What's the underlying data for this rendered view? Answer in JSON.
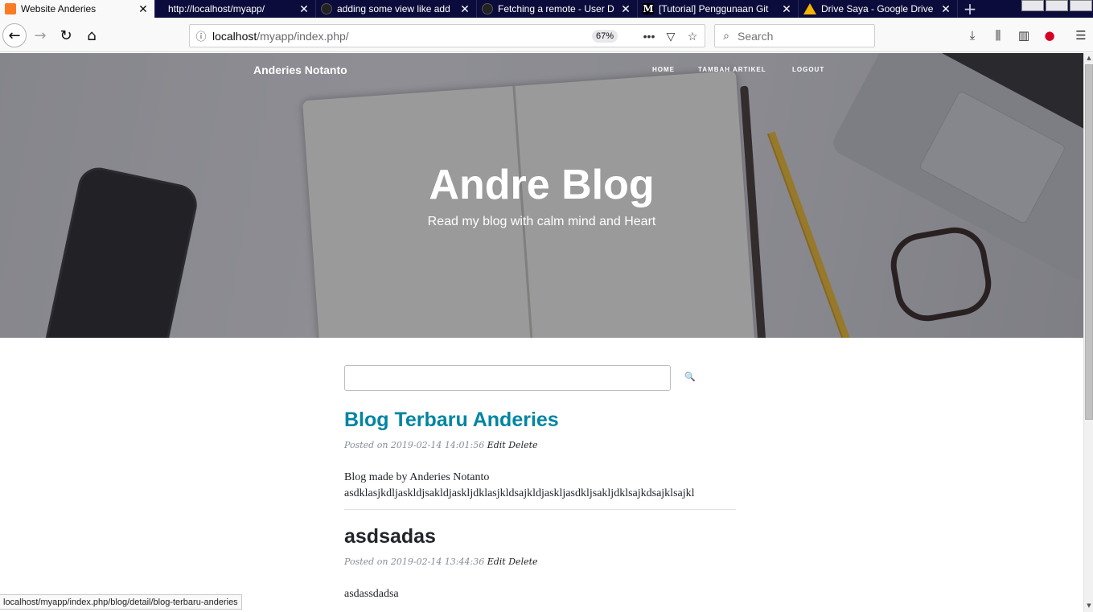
{
  "browser": {
    "tabs": [
      {
        "title": "Website Anderies",
        "favicon": "xampp-icon",
        "active": true
      },
      {
        "title": "http://localhost/myapp/",
        "favicon": "none",
        "active": false
      },
      {
        "title": "adding some view like add",
        "favicon": "github-icon",
        "active": false
      },
      {
        "title": "Fetching a remote - User D",
        "favicon": "github-icon",
        "active": false
      },
      {
        "title": "[Tutorial] Penggunaan Git",
        "favicon": "medium-icon",
        "active": false
      },
      {
        "title": "Drive Saya - Google Drive",
        "favicon": "google-drive-icon",
        "active": false
      }
    ],
    "close_glyph": "✕",
    "new_tab_glyph": "+",
    "url": {
      "host": "localhost",
      "path": "/myapp/index.php/"
    },
    "zoom": "67%",
    "search_placeholder": "Search",
    "medium_glyph": "M",
    "status_url": "localhost/myapp/index.php/blog/detail/blog-terbaru-anderies"
  },
  "site": {
    "brand": "Anderies Notanto",
    "nav": {
      "home": "HOME",
      "tambah": "TAMBAH ARTIKEL",
      "logout": "LOGOUT"
    },
    "hero_title": "Andre Blog",
    "hero_subtitle": "Read my blog with calm mind and Heart",
    "search_value": "",
    "posts": [
      {
        "title": "Blog Terbaru Anderies",
        "posted_on": "Posted on 2019-02-14 14:01:56",
        "edit": "Edit",
        "delete": "Delete",
        "body_line1": "Blog made by Anderies Notanto",
        "body_line2": "asdklasjkdljaskldjsakldjaskljdklasjkldsajkldjaskljasdkljsakljdklsajkdsajklsajkl"
      },
      {
        "title": "asdsadas",
        "posted_on": "Posted on 2019-02-14 13:44:36",
        "edit": "Edit",
        "delete": "Delete",
        "body_line1": "asdassdadsa"
      }
    ]
  },
  "colors": {
    "tabbar": "#0c0c3c",
    "post_link": "#0085a1",
    "post_title": "#212529",
    "meta": "#868e96"
  }
}
